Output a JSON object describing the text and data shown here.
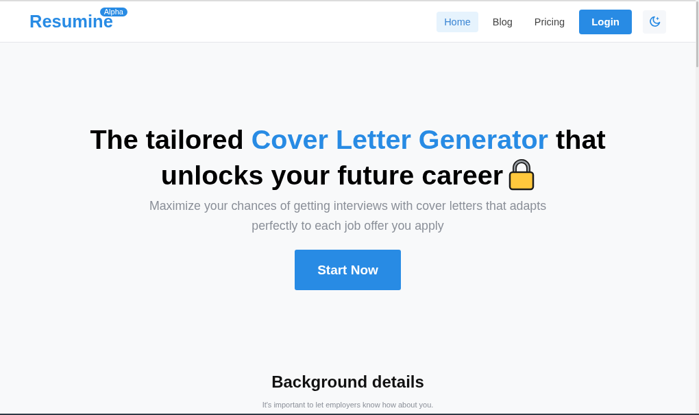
{
  "navbar": {
    "brand": "Resumine",
    "brand_badge": "Alpha",
    "links": [
      {
        "label": "Home",
        "selected": true
      },
      {
        "label": "Blog",
        "selected": false
      },
      {
        "label": "Pricing",
        "selected": false
      }
    ],
    "login_button": "Login"
  },
  "hero": {
    "title_lines": [
      [
        {
          "text": "The tailored ",
          "highlight": false
        },
        {
          "text": "Cover Letter Generator",
          "highlight": true
        },
        {
          "text": " that",
          "highlight": false
        }
      ],
      [
        {
          "text": "unlocks your future career",
          "highlight": false
        }
      ]
    ],
    "subtitle": "Maximize your chances of getting interviews with cover letters that adapts perfectly to each job offer you apply",
    "cta_button": "Start Now"
  },
  "background_section": {
    "heading": "Background details",
    "subtitle": "It's important to let employers know how about you."
  }
}
